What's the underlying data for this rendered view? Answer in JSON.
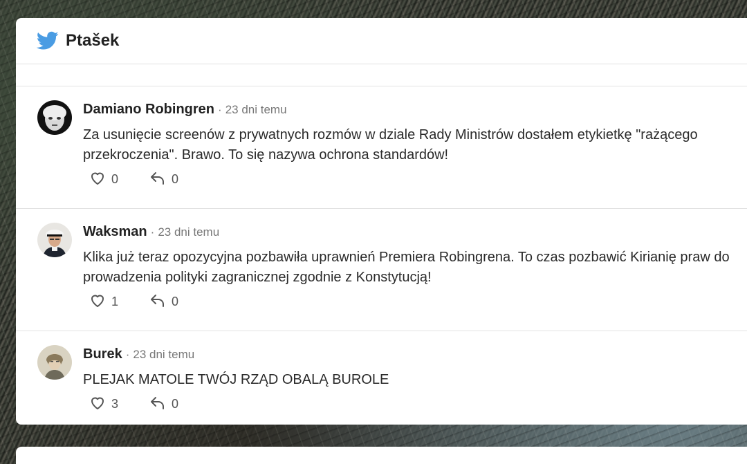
{
  "app": {
    "title": "Ptašek",
    "brand_color": "#4a9ce3"
  },
  "posts": [
    {
      "author": "Damiano Robingren",
      "time": "23 dni temu",
      "text": "Za usunięcie screenów z prywatnych rozmów w dziale Rady Ministrów dostałem etykietkę \"rażącego przekroczenia\". Brawo. To się nazywa ochrona standardów!",
      "likes": "0",
      "replies": "0"
    },
    {
      "author": "Waksman",
      "time": "23 dni temu",
      "text": "Klika już teraz opozycyjna pozbawiła uprawnień Premiera Robingrena. To czas pozbawić Kirianię praw do prowadzenia polityki zagranicznej zgodnie z Konstytucją!",
      "likes": "1",
      "replies": "0"
    },
    {
      "author": "Burek",
      "time": "23 dni temu",
      "text": "PLEJAK MATOLE TWÓJ RZĄD OBALĄ BUROLE",
      "likes": "3",
      "replies": "0"
    }
  ],
  "icons": {
    "like": "heart-icon",
    "reply": "reply-icon",
    "brand": "bird-icon"
  },
  "separator": "·"
}
